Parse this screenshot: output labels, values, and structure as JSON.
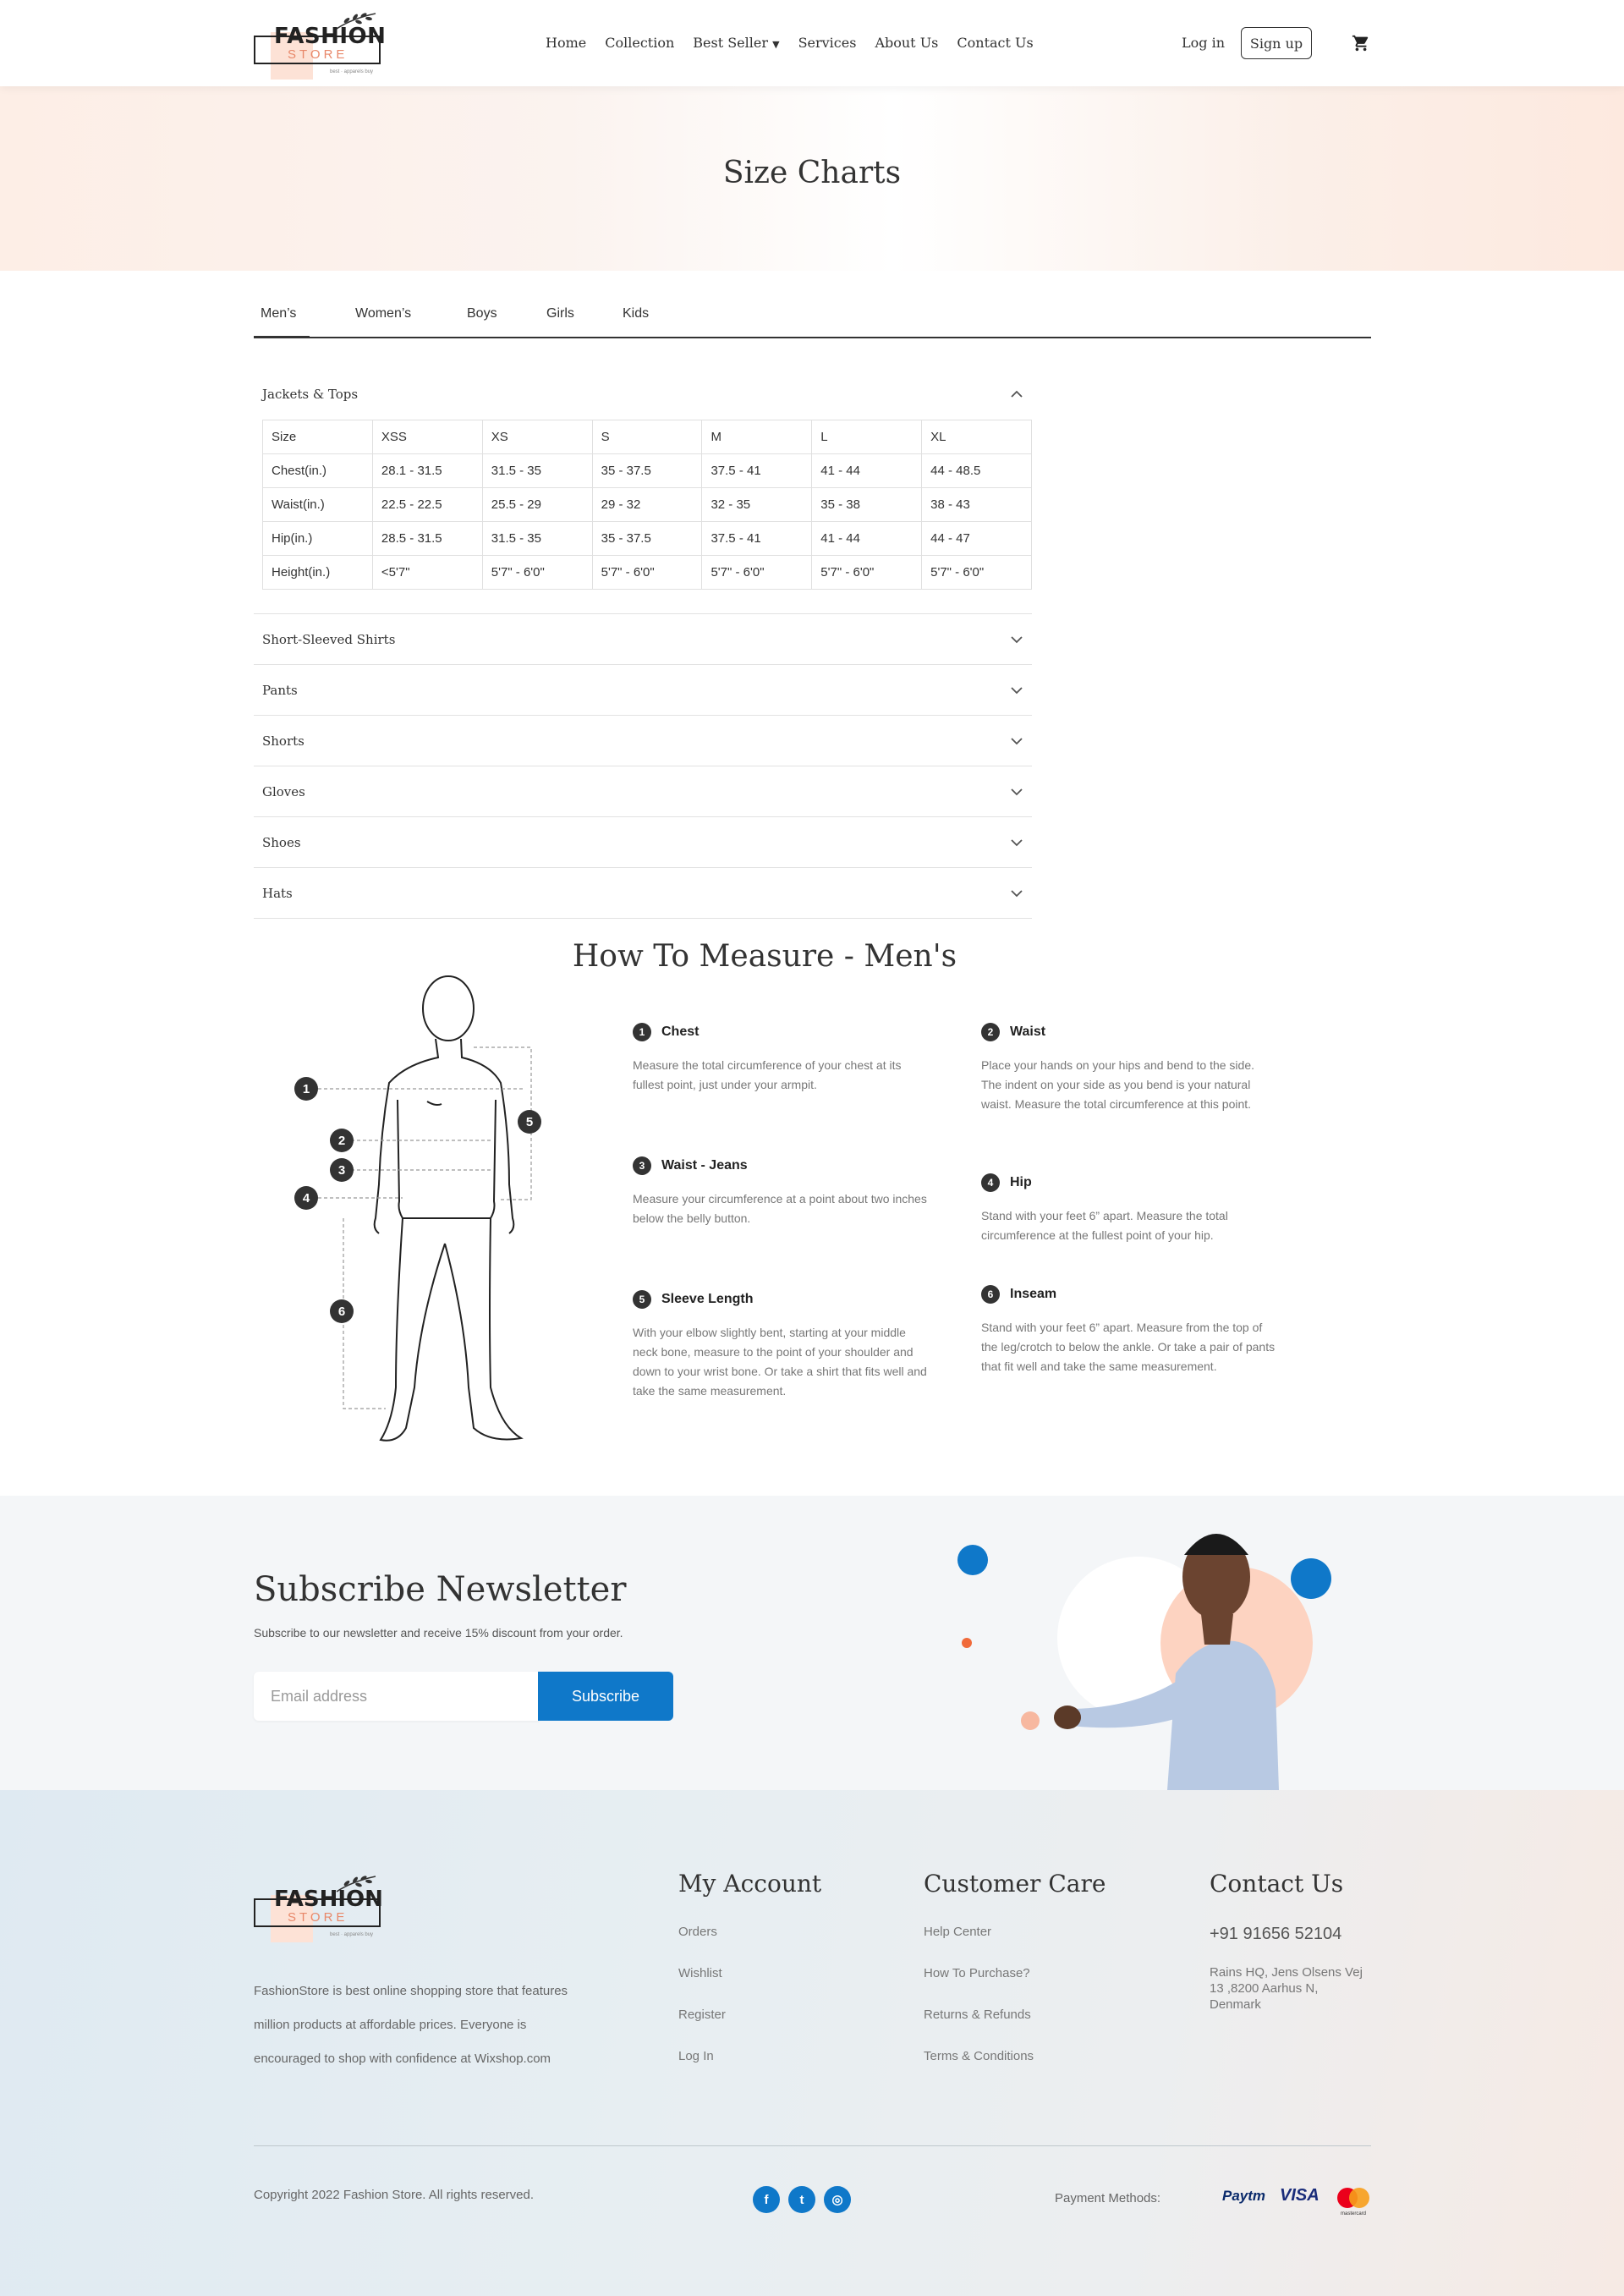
{
  "header": {
    "logo": {
      "main": "FASHION",
      "sub": "STORE",
      "tagline": "best · apparels buy"
    },
    "nav": [
      "Home",
      "Collection",
      "Best Seller",
      "Services",
      "About Us",
      "Contact Us"
    ],
    "active_nav": "Best Seller",
    "login": "Log in",
    "signup": "Sign up"
  },
  "hero": {
    "title": "Size Charts"
  },
  "tabs": [
    "Men’s",
    "Women’s",
    "Boys",
    "Girls",
    "Kids"
  ],
  "accordion": {
    "open_title": "Jackets & Tops",
    "table": {
      "header": [
        "Size",
        "XSS",
        "XS",
        "S",
        "M",
        "L",
        "XL"
      ],
      "rows": [
        [
          "Chest(in.)",
          "28.1 - 31.5",
          "31.5 - 35",
          "35 - 37.5",
          "37.5 - 41",
          "41 - 44",
          "44 - 48.5"
        ],
        [
          "Waist(in.)",
          "22.5 - 22.5",
          "25.5 - 29",
          "29 - 32",
          "32 - 35",
          "35 - 38",
          "38 - 43"
        ],
        [
          "Hip(in.)",
          "28.5 - 31.5",
          "31.5 - 35",
          "35 - 37.5",
          "37.5 - 41",
          "41 - 44",
          "44 - 47"
        ],
        [
          "Height(in.)",
          "<5'7\"",
          "5'7\" - 6'0\"",
          "5'7\" - 6'0\"",
          "5'7\" - 6'0\"",
          "5'7\" - 6'0\"",
          "5'7\" - 6'0\""
        ]
      ]
    },
    "closed": [
      "Short-Sleeved Shirts",
      "Pants",
      "Shorts",
      "Gloves",
      "Shoes",
      "Hats"
    ]
  },
  "measure": {
    "title": "How To Measure - Men's",
    "items": [
      {
        "n": "1",
        "title": "Chest",
        "text": "Measure the total circumference of your chest at its fullest point, just under your armpit."
      },
      {
        "n": "2",
        "title": "Waist",
        "text": "Place your hands on your hips and bend to the side. The indent on your side as you bend is your natural waist. Measure the total circumference at this point."
      },
      {
        "n": "3",
        "title": "Waist - Jeans",
        "text": "Measure your circumference at a point about two inches below the belly button."
      },
      {
        "n": "4",
        "title": "Hip",
        "text": "Stand with your feet 6” apart. Measure the total circumference at the fullest point of your hip."
      },
      {
        "n": "5",
        "title": "Sleeve Length",
        "text": "With your elbow slightly bent, starting at your middle neck bone, measure to the point of your shoulder and down to your wrist bone. Or take a shirt that fits well and take the same measurement."
      },
      {
        "n": "6",
        "title": "Inseam",
        "text": "Stand with your feet 6” apart. Measure from the top of the leg/crotch to below the ankle. Or take a pair of pants that fit well and take the same measurement."
      }
    ],
    "figure_numbers": [
      "1",
      "2",
      "3",
      "4",
      "5",
      "6"
    ]
  },
  "newsletter": {
    "title": "Subscribe Newsletter",
    "subtitle": "Subscribe to our newsletter and receive 15% discount from your order.",
    "placeholder": "Email address",
    "button": "Subscribe"
  },
  "footer": {
    "description": "FashionStore is best online shopping store that features million products at affordable prices. Everyone is encouraged to shop with confidence at Wixshop.com",
    "my_account": {
      "title": "My Account",
      "links": [
        "Orders",
        "Wishlist",
        "Register",
        "Log In"
      ]
    },
    "customer_care": {
      "title": "Customer Care",
      "links": [
        "Help Center",
        "How To Purchase?",
        "Returns & Refunds",
        "Terms & Conditions"
      ]
    },
    "contact": {
      "title": "Contact Us",
      "phone": "+91 91656 52104",
      "address": "Rains HQ, Jens Olsens Vej 13 ,8200 Aarhus N, Denmark"
    },
    "copyright": "Copyright 2022 Fashion Store. All rights reserved.",
    "payment_label": "Payment Methods:",
    "payments": {
      "paytm": "Paytm",
      "visa": "VISA",
      "mastercard": "mastercard"
    },
    "social": [
      "f",
      "t",
      "◎"
    ]
  },
  "colors": {
    "accent": "#0f78c9",
    "peach": "#fde2d6",
    "orange": "#e8886a"
  }
}
